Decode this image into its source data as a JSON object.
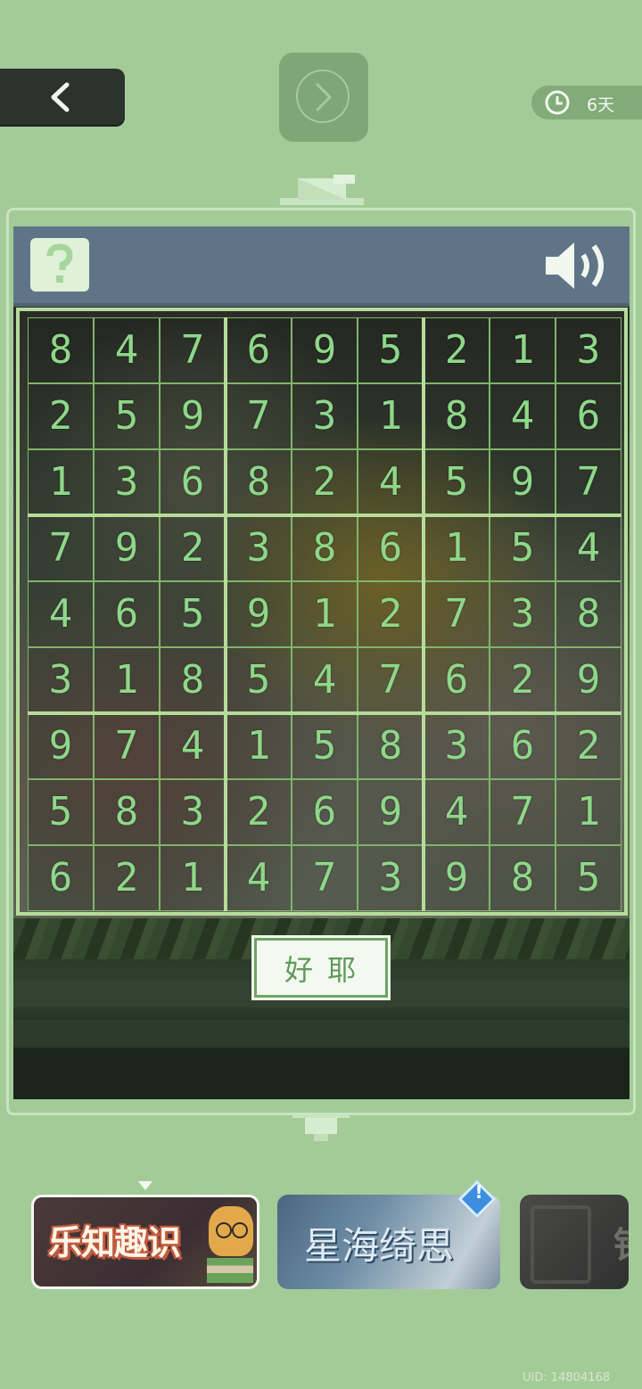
{
  "topbar": {
    "back_icon": "chevron-left-icon",
    "next_icon": "chevron-right-icon",
    "timer_icon": "clock-icon",
    "timer_label": "6天"
  },
  "panel": {
    "help_icon": "question-icon",
    "sound_icon": "speaker-icon"
  },
  "sudoku": {
    "rows": [
      [
        "8",
        "4",
        "7",
        "6",
        "9",
        "5",
        "2",
        "1",
        "3"
      ],
      [
        "2",
        "5",
        "9",
        "7",
        "3",
        "1",
        "8",
        "4",
        "6"
      ],
      [
        "1",
        "3",
        "6",
        "8",
        "2",
        "4",
        "5",
        "9",
        "7"
      ],
      [
        "7",
        "9",
        "2",
        "3",
        "8",
        "6",
        "1",
        "5",
        "4"
      ],
      [
        "4",
        "6",
        "5",
        "9",
        "1",
        "2",
        "7",
        "3",
        "8"
      ],
      [
        "3",
        "1",
        "8",
        "5",
        "4",
        "7",
        "6",
        "2",
        "9"
      ],
      [
        "9",
        "7",
        "4",
        "1",
        "5",
        "8",
        "3",
        "6",
        "2"
      ],
      [
        "5",
        "8",
        "3",
        "2",
        "6",
        "9",
        "4",
        "7",
        "1"
      ],
      [
        "6",
        "2",
        "1",
        "4",
        "7",
        "3",
        "9",
        "8",
        "5"
      ]
    ]
  },
  "confirm_button": {
    "label": "好耶"
  },
  "carousel": {
    "cards": [
      {
        "title": "乐知趣识",
        "selected": true
      },
      {
        "title": "星海绮思",
        "badge": "!"
      },
      {
        "title": "铅"
      }
    ]
  },
  "footer": {
    "uid": "UID: 14804168"
  },
  "colors": {
    "background": "#a3cb97",
    "grid_line": "#b6dc9a",
    "digit": "#8ed889",
    "header": "#5f7587",
    "button_text": "#5f9a58"
  }
}
